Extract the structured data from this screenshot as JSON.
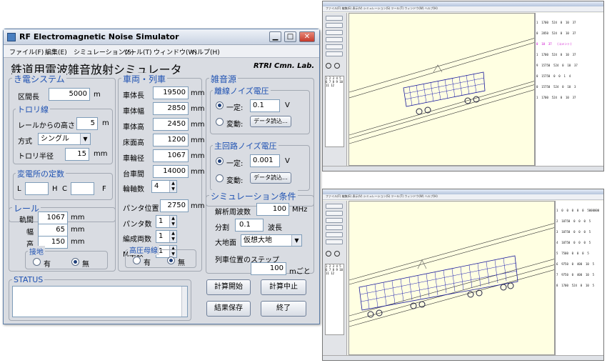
{
  "window": {
    "title": "RF Electromagnetic Noise Simulator",
    "minimize_symbol": "▁",
    "maximize_symbol": "□",
    "close_symbol": "✕"
  },
  "menu": [
    "ファイル(F)",
    "編集(E)",
    "シミュレーション(S)",
    "ツール(T)",
    "ウィンドウ(W)",
    "ヘルプ(H)"
  ],
  "heading": "鉄道用電波雑音放射シミュレータ",
  "brand": "RTRI Cmn. Lab.",
  "feeder_system": {
    "title": "き電システム",
    "section_length_label": "区間長",
    "section_length_value": "5000",
    "section_length_unit": "m",
    "trolley": {
      "title": "トロリ線",
      "height_label": "レールからの高さ",
      "height_value": "5",
      "height_unit": "m",
      "method_label": "方式",
      "method_value": "シングル",
      "radius_label": "トロリ半径",
      "radius_value": "15",
      "radius_unit": "mm"
    },
    "substation": {
      "title": "変電所の定数",
      "l_label": "L",
      "h_label": "H",
      "c_label": "C",
      "f_label": "F",
      "l_value": "",
      "c_value": ""
    }
  },
  "rail": {
    "title": "レール",
    "gauge_label": "軌間",
    "gauge_value": "1067",
    "gauge_unit": "mm",
    "width_label": "幅",
    "width_value": "65",
    "width_unit": "mm",
    "height_label": "高",
    "height_value": "150",
    "height_unit": "mm",
    "ground": {
      "title": "接地",
      "yes_label": "有",
      "no_label": "無",
      "selected": "no"
    }
  },
  "vehicle": {
    "title": "車両・列車",
    "rows": [
      {
        "label": "車体長",
        "value": "19500",
        "unit": "mm"
      },
      {
        "label": "車体幅",
        "value": "2850",
        "unit": "mm"
      },
      {
        "label": "車体高",
        "value": "2450",
        "unit": "mm"
      },
      {
        "label": "床面高",
        "value": "1200",
        "unit": "mm"
      },
      {
        "label": "車輪径",
        "value": "1067",
        "unit": "mm"
      },
      {
        "label": "台車間",
        "value": "14000",
        "unit": "mm"
      }
    ],
    "axle_label": "輪軸数",
    "axle_value": "4",
    "pantograph_pos_label": "パンタ位置",
    "pantograph_pos_value": "2750",
    "pantograph_pos_unit": "mm",
    "pantograph_count_label": "パンタ数",
    "pantograph_count_value": "1",
    "cars_label": "編成両数",
    "cars_value": "1",
    "m_cars_label": "M車数",
    "m_cars_value": "1",
    "hv_bus": {
      "title": "高圧母線",
      "yes_label": "有",
      "no_label": "無",
      "selected": "no"
    }
  },
  "noise_source": {
    "title": "雑音源",
    "arc": {
      "title": "離線ノイズ電圧",
      "constant_label": "一定:",
      "constant_value": "0.1",
      "constant_unit": "V",
      "variable_label": "変動:",
      "load_button": "データ読込...",
      "selected": "constant"
    },
    "main_circuit": {
      "title": "主回路ノイズ電圧",
      "constant_label": "一定:",
      "constant_value": "0.001",
      "constant_unit": "V",
      "variable_label": "変動:",
      "load_button": "データ読込...",
      "selected": "constant"
    }
  },
  "sim_conditions": {
    "title": "シミュレーション条件",
    "freq_label": "解析周波数",
    "freq_value": "100",
    "freq_unit": "MHz",
    "division_label": "分割",
    "division_value": "0.1",
    "division_unit": "波長",
    "ground_label": "大地面",
    "ground_value": "仮想大地",
    "step_label": "列車位置のステップ",
    "step_value": "100",
    "step_unit": "mごと"
  },
  "status": {
    "title": "STATUS",
    "text": ""
  },
  "buttons": {
    "start": "計算開始",
    "stop": "計算中止",
    "save": "結果保存",
    "exit": "終了"
  },
  "screenshot_panels": [
    {
      "menu_text": "ファイル(F)  編集(E)  表示(V)  シミュレーション(S)  ツール(T)  ウィンドウ(W)  ヘルプ(H)",
      "side_list": "1 2 3 4 5 6 7 8 9 10 11 12",
      "text_lines": [
        "1  1700  524  0  10  37",
        "0  2850  524  0  10  37",
        "0  10  37   (コメント)",
        "1  1700  524  0  10  37",
        "9  15750  524  0  10  37",
        "0  15750  0  0  1  4",
        "0  15750  524  0  10  3",
        "1  1700  524  0  10  37"
      ]
    },
    {
      "menu_text": "ファイル(F)  編集(E)  表示(V)  シミュレーション(S)  ツール(T)  ウィンドウ(W)  ヘルプ(H)",
      "side_list": "1 2 3 4 5 6 7 8 9 10 11 12",
      "text_lines": [
        "1  0  0  0  0  0  5000000",
        "2  10750  0  0  0  5",
        "3  10750  0  0  0  5",
        "4  10750  0  0  0  5",
        "5  7500  0  0  0  5",
        "6  9750  0  400  10  5",
        "7  9750  0  400  10  5",
        "8  1700  524  0  10  5"
      ]
    }
  ]
}
